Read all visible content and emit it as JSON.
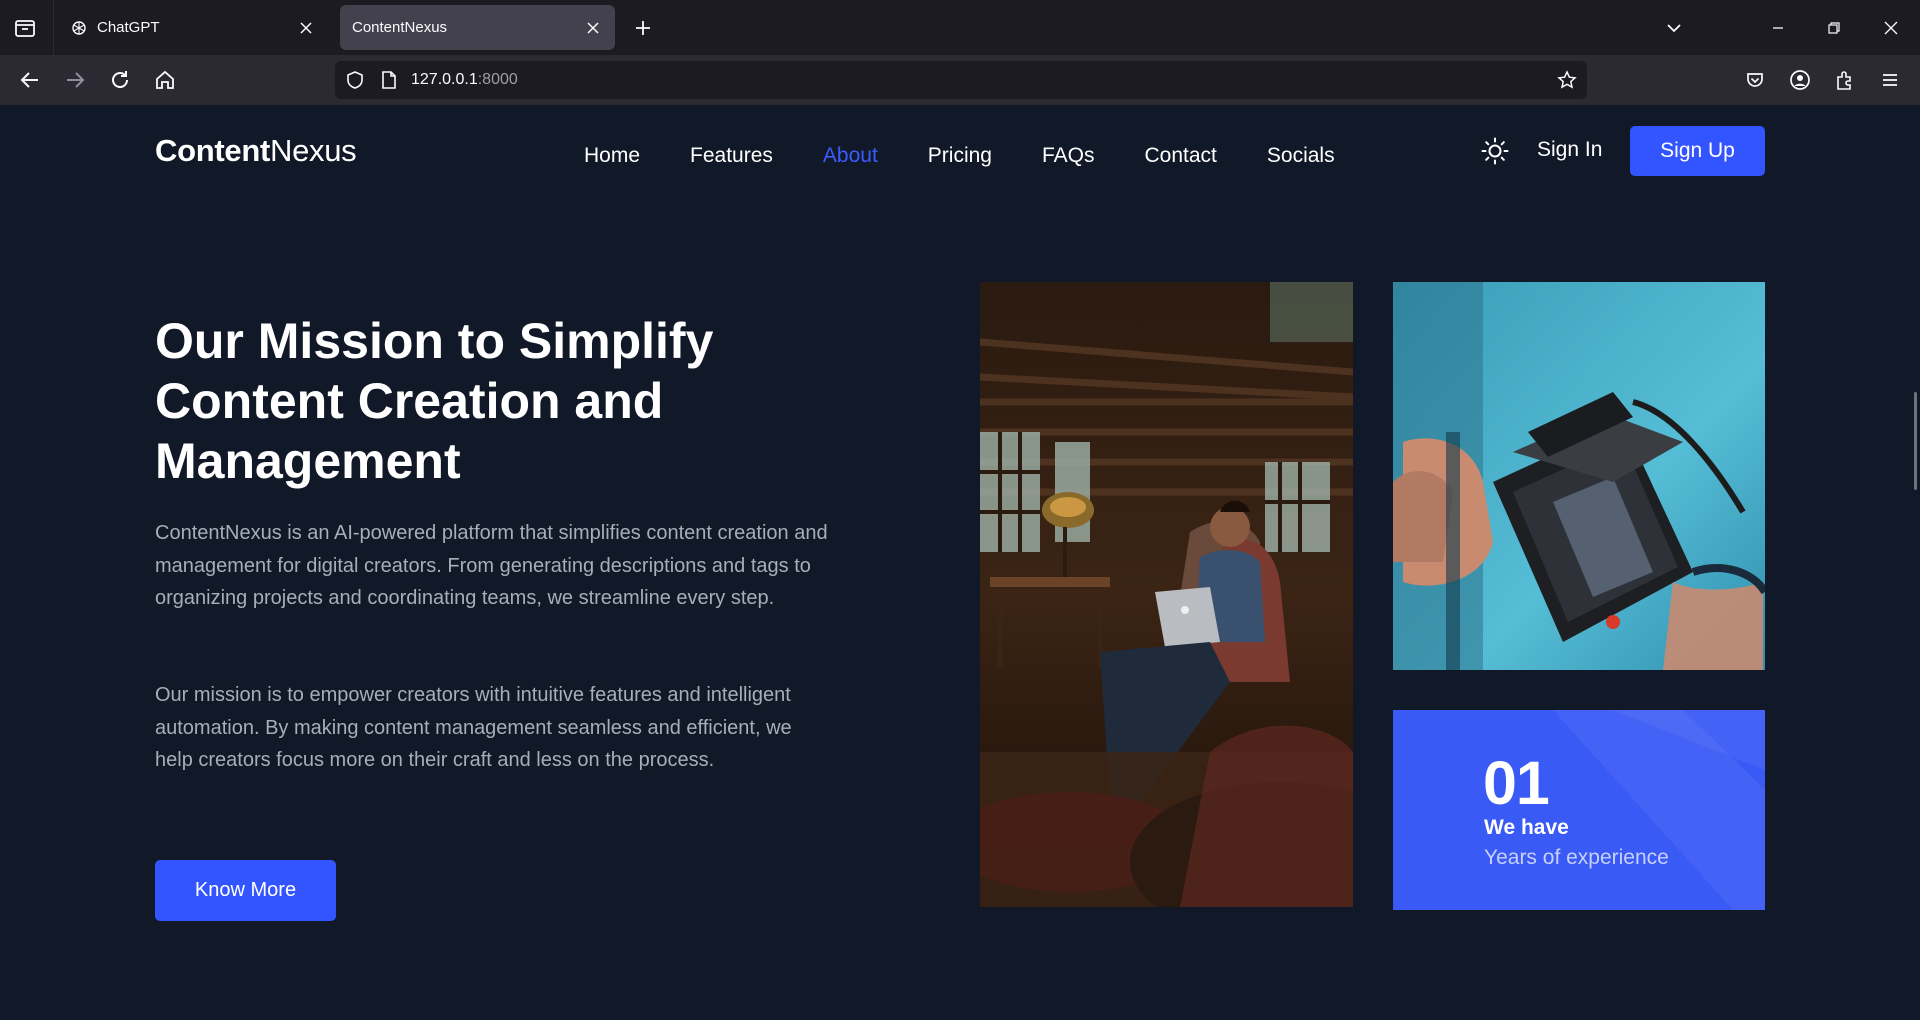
{
  "browser": {
    "tabs": [
      {
        "label": "ChatGPT",
        "icon": "openai-icon",
        "active": false
      },
      {
        "label": "ContentNexus",
        "icon": "none",
        "active": true
      }
    ],
    "url_host": "127.0.0.1",
    "url_port": ":8000"
  },
  "site": {
    "logo_bold": "Content",
    "logo_light": "Nexus",
    "nav": [
      "Home",
      "Features",
      "About",
      "Pricing",
      "FAQs",
      "Contact",
      "Socials"
    ],
    "active_nav": "About",
    "sign_in": "Sign In",
    "sign_up": "Sign Up",
    "accent_color": "#3355ff"
  },
  "hero": {
    "headline_line1": "Our Mission to Simplify",
    "headline_line2": "Content Creation and",
    "headline_line3": "Management",
    "paragraph1": "ContentNexus is an AI-powered platform that simplifies content creation and management for digital creators. From generating descriptions and tags to organizing projects and coordinating teams, we streamline every step.",
    "paragraph2": "Our mission is to empower creators with intuitive features and intelligent automation. By making content management seamless and efficient, we help creators focus more on their craft and less on the process.",
    "cta": "Know More"
  },
  "stat": {
    "number": "01",
    "line1": "We have",
    "line2": "Years of experience"
  }
}
